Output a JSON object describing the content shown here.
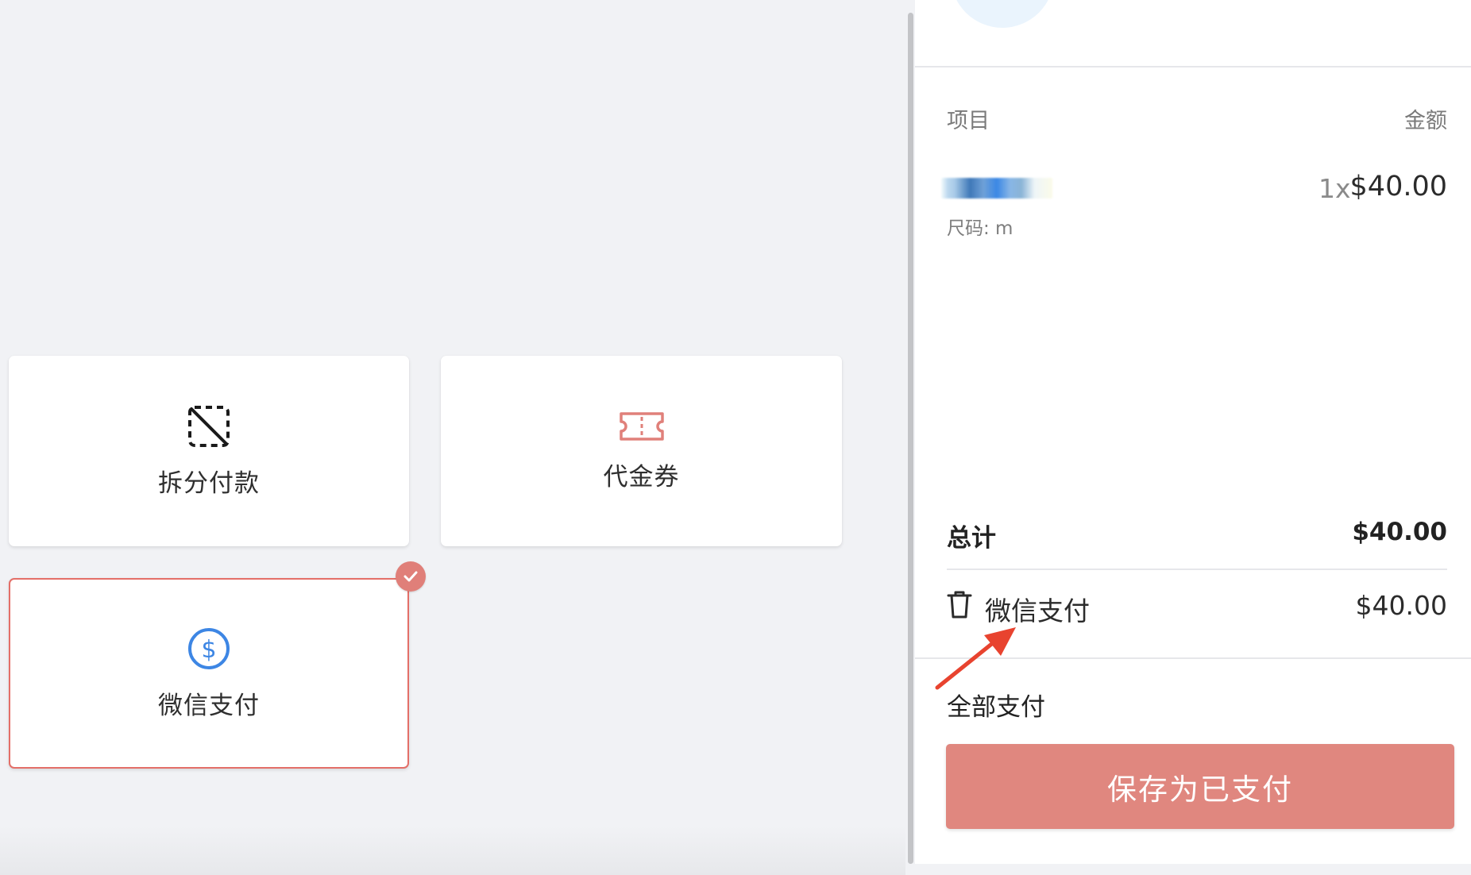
{
  "payment_methods": [
    {
      "label": "拆分付款",
      "icon": "split-payment-icon"
    },
    {
      "label": "代金券",
      "icon": "voucher-ticket-icon"
    },
    {
      "label": "微信支付",
      "icon": "dollar-circle-icon",
      "selected": true
    }
  ],
  "order": {
    "columns": {
      "item": "项目",
      "amount": "金额"
    },
    "items": [
      {
        "name_redacted": true,
        "meta": "尺码: m",
        "qty": "1x",
        "price": "$40.00"
      }
    ],
    "total_label": "总计",
    "total_value": "$40.00",
    "payments": [
      {
        "method": "微信支付",
        "amount": "$40.00"
      }
    ],
    "pay_all_label": "全部支付",
    "save_button": "保存为已支付"
  },
  "colors": {
    "accent": "#e0877f",
    "selected_border": "#e46f68",
    "voucher_icon": "#e0807a",
    "dollar_icon": "#3d86e4",
    "annotation_arrow": "#e8432f"
  }
}
